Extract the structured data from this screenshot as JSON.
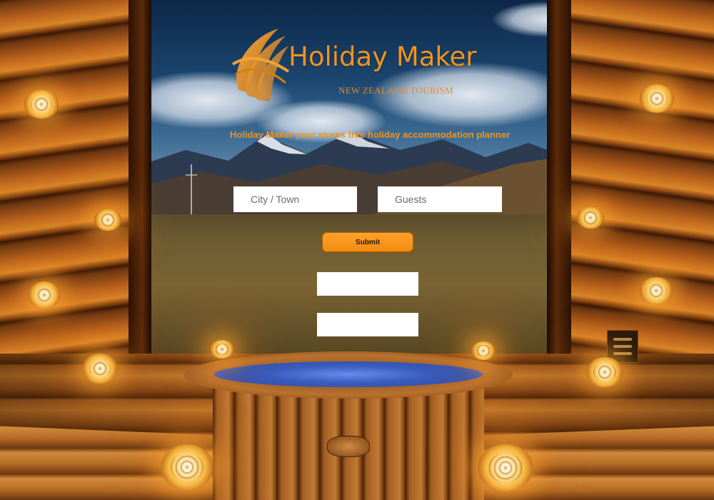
{
  "brand": {
    "title": "Holiday Maker",
    "subtitle": "NEW ZEALAND TOURISM",
    "logo_icon": "swoosh-h-logo-icon",
    "accent_color": "#f0941f"
  },
  "tagline": "Holiday Maker your stress free holiday accommodation planner",
  "search": {
    "city_placeholder": "City / Town",
    "city_value": "",
    "guests_placeholder": "Guests",
    "guests_value": "",
    "submit_label": "Submit",
    "submit_color": "#f48c0e"
  },
  "results": {
    "box1": "",
    "box2": ""
  }
}
